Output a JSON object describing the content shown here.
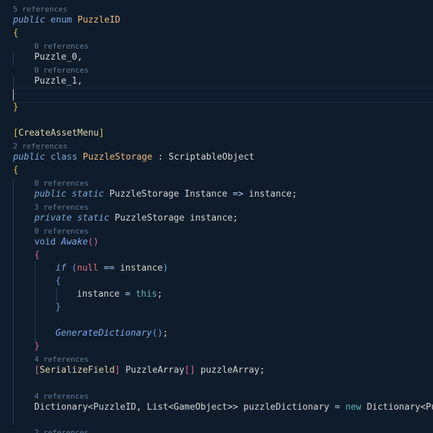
{
  "code_lens": {
    "refs_5": "5 references",
    "refs_0": "0 references",
    "refs_2": "2 references",
    "refs_3": "3 references",
    "refs_4": "4 references"
  },
  "code": {
    "kw_public": "public",
    "kw_enum": "enum",
    "kw_class": "class",
    "kw_static": "static",
    "kw_private": "private",
    "kw_void": "void",
    "kw_if": "if",
    "kw_null": "null",
    "kw_this": "this",
    "kw_new": "new",
    "enum_name": "PuzzleID",
    "enum_value_0": "Puzzle_0,",
    "enum_value_1": "Puzzle_1,",
    "attr_create_asset_menu": "CreateAssetMenu",
    "attr_serialize_field": "SerializeField",
    "class_name": "PuzzleStorage",
    "base_class": "ScriptableObject",
    "prop_type": "PuzzleStorage",
    "prop_instance": "Instance",
    "arrow": "=>",
    "field_instance_semicolon": "instance;",
    "field_instance": "instance",
    "method_awake": "Awake",
    "op_eq": "==",
    "op_assign": "=",
    "method_generate_dictionary": "GenerateDictionary",
    "type_puzzle_array": "PuzzleArray",
    "field_puzzle_array": "puzzleArray;",
    "type_dictionary": "Dictionary",
    "type_puzzle_id": "PuzzleID",
    "type_list": "List",
    "type_gameobject": "GameObject",
    "field_puzzle_dictionary": "puzzleDictionary",
    "type_dictionary_trunc": "Dictionary<Puz"
  },
  "colors": {
    "background": "#0f1c2b",
    "keyword": "#7da6d9",
    "type": "#e8b87a",
    "code_lens": "#5f7a94"
  }
}
